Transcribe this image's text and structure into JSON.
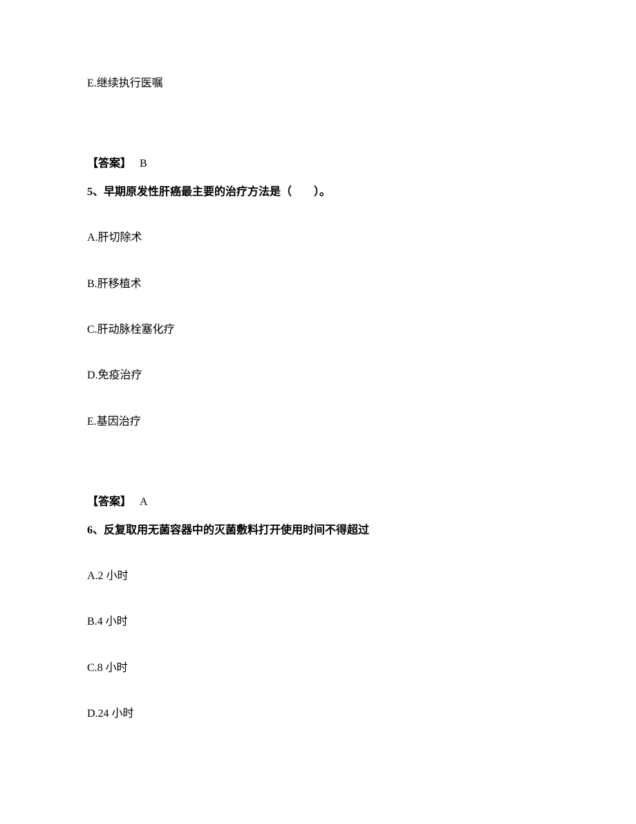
{
  "q4": {
    "option_e": "E.继续执行医嘱",
    "answer_label": "【答案】",
    "answer_value": "B"
  },
  "q5": {
    "stem": "5、早期原发性肝癌最主要的治疗方法是（　　）。",
    "option_a": "A.肝切除术",
    "option_b": "B.肝移植术",
    "option_c": "C.肝动脉栓塞化疗",
    "option_d": "D.免疫治疗",
    "option_e": "E.基因治疗",
    "answer_label": "【答案】",
    "answer_value": "A"
  },
  "q6": {
    "stem": "6、反复取用无菌容器中的灭菌敷料打开使用时间不得超过",
    "option_a": "A.2 小时",
    "option_b": "B.4 小时",
    "option_c": "C.8 小时",
    "option_d": "D.24 小时"
  }
}
